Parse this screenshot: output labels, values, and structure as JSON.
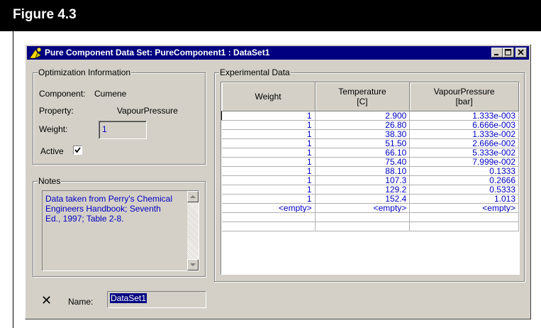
{
  "figure": {
    "title": "Figure 4.3"
  },
  "window": {
    "title": "Pure Component Data Set: PureComponent1 : DataSet1",
    "buttons": [
      "minimize-icon",
      "maximize-icon",
      "close-icon"
    ]
  },
  "optimization": {
    "group_label": "Optimization Information",
    "component_label": "Component:",
    "component_value": "Cumene",
    "property_label": "Property:",
    "property_value": "VapourPressure",
    "weight_label": "Weight:",
    "weight_value": "1",
    "active_label": "Active",
    "active_checked": true
  },
  "notes": {
    "group_label": "Notes",
    "lines": [
      "Data taken from Perry's Chemical",
      "Engineers Handbook; Seventh",
      "Ed., 1997; Table 2-8."
    ]
  },
  "experimental": {
    "group_label": "Experimental Data",
    "columns": [
      {
        "line1": "Weight",
        "line2": ""
      },
      {
        "line1": "Temperature",
        "line2": "[C]"
      },
      {
        "line1": "VapourPressure",
        "line2": "[bar]"
      }
    ],
    "rows": [
      [
        "1",
        "2.900",
        "1.333e-003"
      ],
      [
        "1",
        "26.80",
        "6.666e-003"
      ],
      [
        "1",
        "38.30",
        "1.333e-002"
      ],
      [
        "1",
        "51.50",
        "2.666e-002"
      ],
      [
        "1",
        "66.10",
        "5.333e-002"
      ],
      [
        "1",
        "75.40",
        "7.999e-002"
      ],
      [
        "1",
        "88.10",
        "0.1333"
      ],
      [
        "1",
        "107.3",
        "0.2666"
      ],
      [
        "1",
        "129.2",
        "0.5333"
      ],
      [
        "1",
        "152.4",
        "1.013"
      ],
      [
        "<empty>",
        "<empty>",
        "<empty>"
      ]
    ]
  },
  "footer": {
    "delete_icon": "x-icon",
    "name_label": "Name:",
    "name_value": "DataSet1"
  }
}
